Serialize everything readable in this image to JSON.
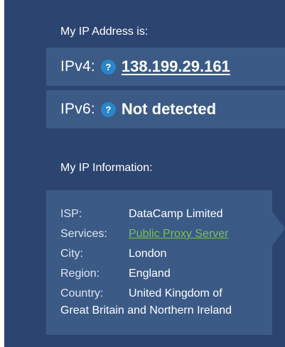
{
  "ip_address": {
    "heading": "My IP Address is:",
    "ipv4": {
      "label": "IPv4:",
      "help_icon": "question-mark-icon",
      "value": "138.199.29.161"
    },
    "ipv6": {
      "label": "IPv6:",
      "help_icon": "question-mark-icon",
      "value": "Not detected"
    }
  },
  "ip_information": {
    "heading": "My IP Information:",
    "rows": [
      {
        "key": "ISP:",
        "value": "DataCamp Limited"
      },
      {
        "key": "Services:",
        "value": "Public Proxy Server"
      },
      {
        "key": "City:",
        "value": "London"
      },
      {
        "key": "Region:",
        "value": "England"
      },
      {
        "key": "Country:",
        "value": "United Kingdom of",
        "value_continued": "Great Britain and Northern Ireland"
      }
    ]
  },
  "colors": {
    "panel_background": "#2c4470",
    "row_background": "#3b5a86",
    "help_icon": "#2a86c9",
    "service_link": "#79c24f"
  }
}
